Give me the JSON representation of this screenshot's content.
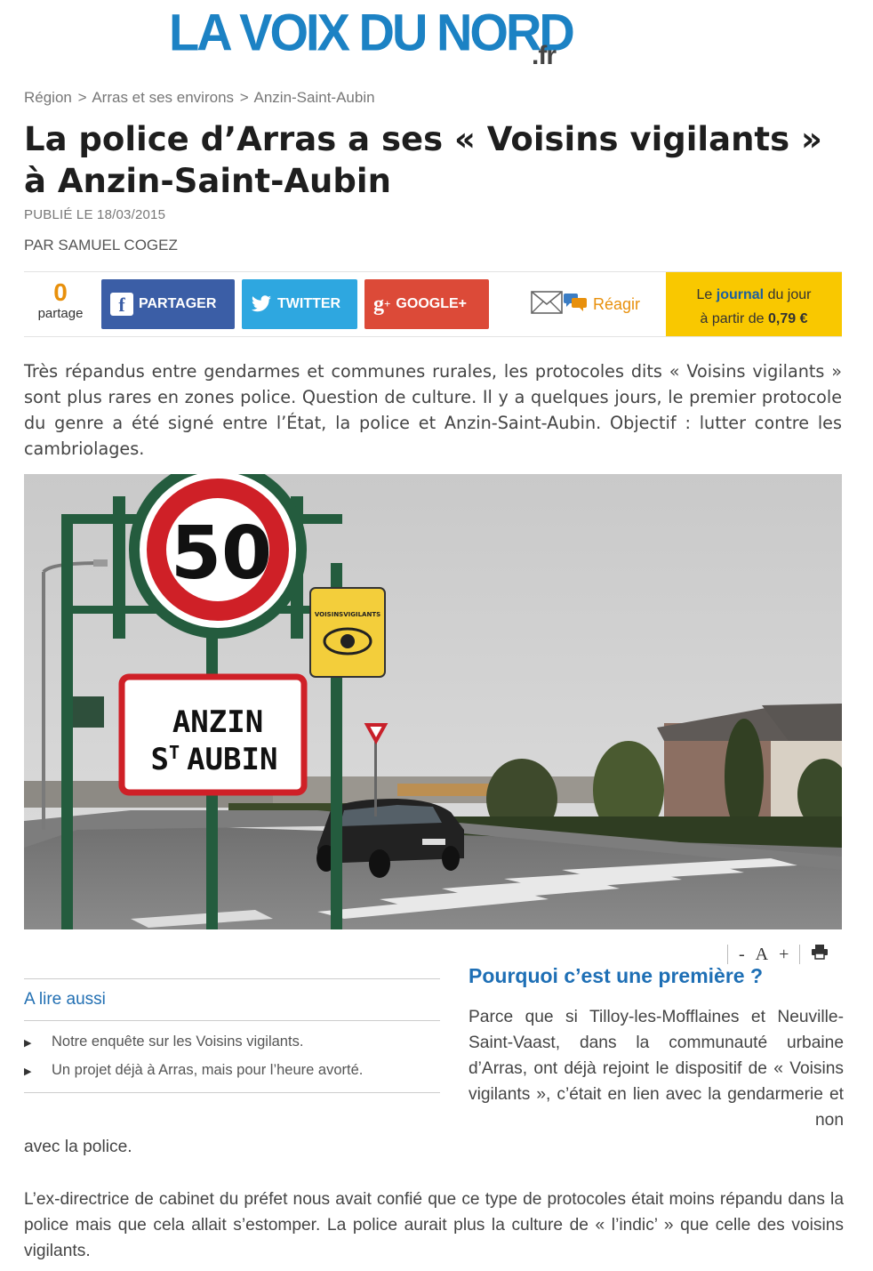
{
  "site": {
    "logo_main": "LA VOIX DU NORD",
    "logo_suffix": ".fr"
  },
  "breadcrumb": {
    "items": [
      "Région",
      "Arras et ses environs",
      "Anzin-Saint-Aubin"
    ],
    "separator": ">"
  },
  "article": {
    "title": "La police d’Arras a ses « Voisins vigilants » à Anzin-Saint-Aubin",
    "published": "PUBLIÉ LE 18/03/2015",
    "author": "PAR SAMUEL COGEZ",
    "lead": "Très répandus entre gendarmes et communes rurales, les protocoles dits « Voisins vigilants » sont plus rares en zones police. Question de culture. Il y a quelques jours, le premier protocole du genre a été signé entre l’État, la police et Anzin-Saint-Aubin. Objectif : lutter contre les cambriolages.",
    "subheading": "Pourquoi c’est une première ?",
    "para1_side": "Parce que si Tilloy-les-Mofflaines et Neuville-Saint-Vaast, dans la communauté urbaine d’Arras, ont déjà rejoint le dispositif de « Voisins vigilants », c’était en lien avec la gendarmerie et non",
    "para1_cont": "avec la police.",
    "para2": "L’ex-directrice de cabinet du préfet nous avait confié que ce type de protocoles était moins répandu dans la police mais que cela allait s’estomper. La police aurait plus la culture de « l’indic’ » que celle des voisins vigilants."
  },
  "share": {
    "count": "0",
    "count_label": "partage",
    "facebook": "PARTAGER",
    "twitter": "TWITTER",
    "google": "GOOGLE+",
    "react": "Réagir",
    "journal_line1_a": "Le",
    "journal_line1_b": "journal",
    "journal_line1_c": "du jour",
    "journal_line2_a": "à partir de",
    "journal_price": "0,79 €"
  },
  "photo": {
    "speed_sign": "50",
    "town_line1": "ANZIN",
    "town_line2_a": "S",
    "town_line2_sup": "T",
    "town_line2_b": "AUBIN",
    "vigilant_label": "VOISINSVIGILANTS"
  },
  "tools": {
    "minus": "-",
    "font": "A",
    "plus": "+"
  },
  "related": {
    "title": "A lire aussi",
    "items": [
      "Notre enquête sur les Voisins vigilants.",
      "Un projet déjà à Arras, mais pour l’heure avorté."
    ]
  },
  "colors": {
    "brand_blue": "#1c82c4",
    "facebook": "#3b5ea6",
    "twitter": "#2ea7e0",
    "google": "#dc4a38",
    "journal_bg": "#f9c800",
    "accent_orange": "#e8900c"
  }
}
